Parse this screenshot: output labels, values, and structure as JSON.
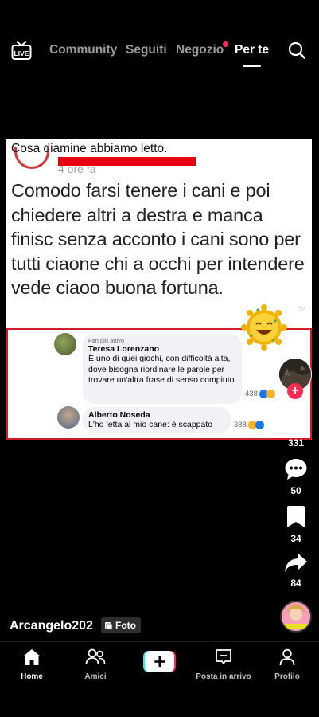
{
  "topnav": {
    "tabs": [
      {
        "label": "Community",
        "active": false
      },
      {
        "label": "Seguiti",
        "active": false
      },
      {
        "label": "Negozio",
        "active": false,
        "dot": true
      },
      {
        "label": "Per te",
        "active": true
      }
    ]
  },
  "post": {
    "caption": "Cosa diamine abbiamo letto.",
    "hidden_time": "4 ore fa",
    "text": "Comodo farsi tenere i cani e poi chiedere altri a destra e manca finisc senza acconto i cani sono per tutti ciaone chi a occhi per intendere vede ciaoo buona fortuna.",
    "comments": [
      {
        "badge": "Fan più attivo",
        "name": "Teresa Lorenzano",
        "body": "È uno di quei giochi, con difficoltà alta, dove bisogna riordinare le parole per trovare un'altra frase di senso compiuto",
        "reactions": "438"
      },
      {
        "name": "Alberto Noseda",
        "body": "L'ho letta al mio cane: è scappato",
        "reactions": "388"
      }
    ],
    "sticker_mark": "TM"
  },
  "rail": {
    "likes": "331",
    "comments": "50",
    "saves": "34",
    "shares": "84"
  },
  "author": {
    "username": "Arcangelo202",
    "type_badge": "Foto"
  },
  "bottomnav": {
    "items": [
      {
        "label": "Home",
        "active": true
      },
      {
        "label": "Amici",
        "active": false
      },
      {
        "label": "Posta in arrivo",
        "active": false
      },
      {
        "label": "Profilo",
        "active": false
      }
    ]
  },
  "colors": {
    "accent": "#fe2c55",
    "highlight_red": "#e60012",
    "teal": "#25f4ee"
  }
}
